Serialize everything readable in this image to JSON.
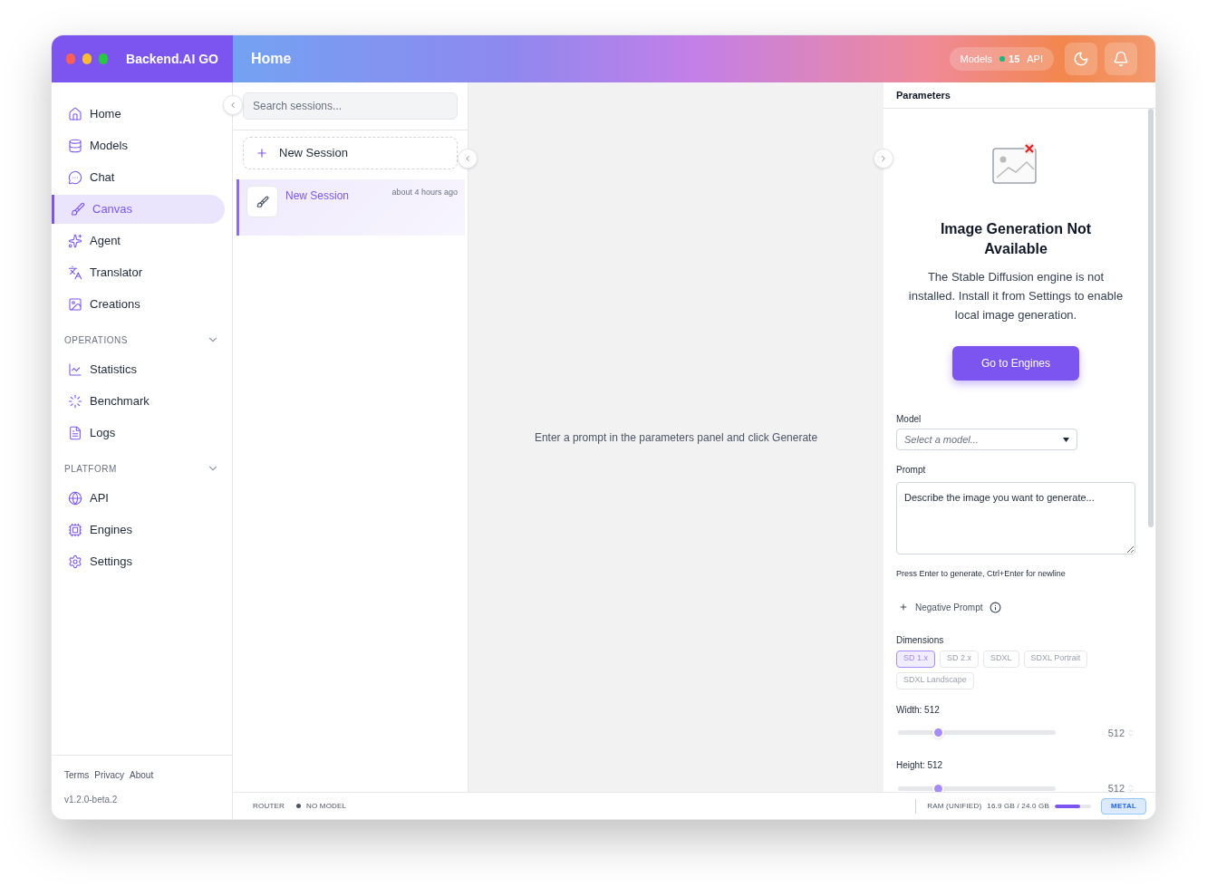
{
  "app": {
    "title": "Backend.AI GO"
  },
  "header": {
    "title": "Home",
    "models_label": "Models",
    "api_count": "15",
    "api_label": "API"
  },
  "sidebar": {
    "groups": [
      {
        "items": [
          {
            "label": "Home",
            "kind": "home",
            "selected": false
          },
          {
            "label": "Models",
            "kind": "database",
            "selected": false
          },
          {
            "label": "Chat",
            "kind": "chat",
            "selected": false
          },
          {
            "label": "Canvas",
            "kind": "brush",
            "selected": true
          },
          {
            "label": "Agent",
            "kind": "sparkles",
            "selected": false
          },
          {
            "label": "Translator",
            "kind": "languages",
            "selected": false
          },
          {
            "label": "Creations",
            "kind": "image",
            "selected": false
          }
        ]
      },
      {
        "heading": "OPERATIONS",
        "expanded": true,
        "items": [
          {
            "label": "Statistics",
            "kind": "chart",
            "selected": false
          },
          {
            "label": "Benchmark",
            "kind": "loader",
            "selected": false
          },
          {
            "label": "Logs",
            "kind": "file",
            "selected": false
          }
        ]
      },
      {
        "heading": "PLATFORM",
        "expanded": true,
        "items": [
          {
            "label": "API",
            "kind": "globe",
            "selected": false
          },
          {
            "label": "Engines",
            "kind": "cpu",
            "selected": false
          },
          {
            "label": "Settings",
            "kind": "settings",
            "selected": false
          }
        ]
      }
    ],
    "footer_links": [
      "Terms",
      "Privacy",
      "About"
    ],
    "version": "v1.2.0-beta.2"
  },
  "sessions": {
    "search_placeholder": "Search sessions...",
    "new_label": "New Session",
    "items": [
      {
        "title": "New Session",
        "time": "about 4 hours ago",
        "selected": true
      }
    ]
  },
  "main": {
    "message": "Enter a prompt in the parameters panel and click Generate"
  },
  "parameters": {
    "title": "Parameters",
    "notice": {
      "heading": "Image Generation Not Available",
      "body": "The Stable Diffusion engine is not installed. Install it from Settings to enable local image generation.",
      "button": "Go to Engines"
    },
    "model": {
      "label": "Model",
      "placeholder": "Select a model..."
    },
    "prompt": {
      "label": "Prompt",
      "placeholder": "Describe the image you want to generate...",
      "hint": "Press Enter to generate, Ctrl+Enter for newline"
    },
    "negative_prompt": {
      "label": "Negative Prompt"
    },
    "dimensions": {
      "label": "Dimensions",
      "presets": [
        {
          "label": "SD 1.x",
          "selected": true
        },
        {
          "label": "SD 2.x",
          "selected": false
        },
        {
          "label": "SDXL",
          "selected": false
        },
        {
          "label": "SDXL Portrait",
          "selected": false
        },
        {
          "label": "SDXL Landscape",
          "selected": false
        }
      ]
    },
    "sliders": [
      {
        "label": "Width: 512",
        "level": 0.25,
        "reading": "512"
      },
      {
        "label": "Height: 512",
        "level": 0.25,
        "reading": "512"
      }
    ]
  },
  "status_bar": {
    "router": "ROUTER",
    "model_status": "NO MODEL",
    "ram_label": "RAM (UNIFIED)",
    "ram_value": "16.9 GB / 24.0 GB",
    "ram": {
      "level": 0.7
    },
    "backend": "METAL"
  }
}
